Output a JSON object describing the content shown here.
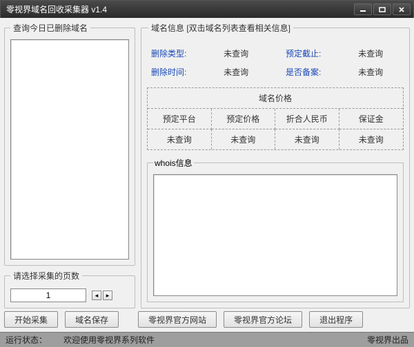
{
  "window": {
    "title": "零视界域名回收采集器 v1.4"
  },
  "left": {
    "list_legend": "查询今日已删除域名",
    "pages_legend": "请选择采集的页数",
    "pages_value": "1"
  },
  "right": {
    "legend": "域名信息 [双击域名列表查看相关信息]",
    "info": {
      "delete_type_label": "删除类型:",
      "delete_type_value": "未查询",
      "delete_time_label": "删除时间:",
      "delete_time_value": "未查询",
      "reserve_stop_label": "预定截止:",
      "reserve_stop_value": "未查询",
      "beian_label": "是否备案:",
      "beian_value": "未查询"
    },
    "price": {
      "title": "域名价格",
      "headers": [
        "预定平台",
        "预定价格",
        "折合人民币",
        "保证金"
      ],
      "values": [
        "未查询",
        "未查询",
        "未查询",
        "未查询"
      ]
    },
    "whois_legend": "whois信息"
  },
  "buttons": {
    "start": "开始采集",
    "save": "域名保存",
    "site": "零视界官方网站",
    "forum": "零视界官方论坛",
    "exit": "退出程序"
  },
  "status": {
    "label": "运行状态：",
    "text": "欢迎使用零视界系列软件",
    "brand": "零视界出品"
  }
}
